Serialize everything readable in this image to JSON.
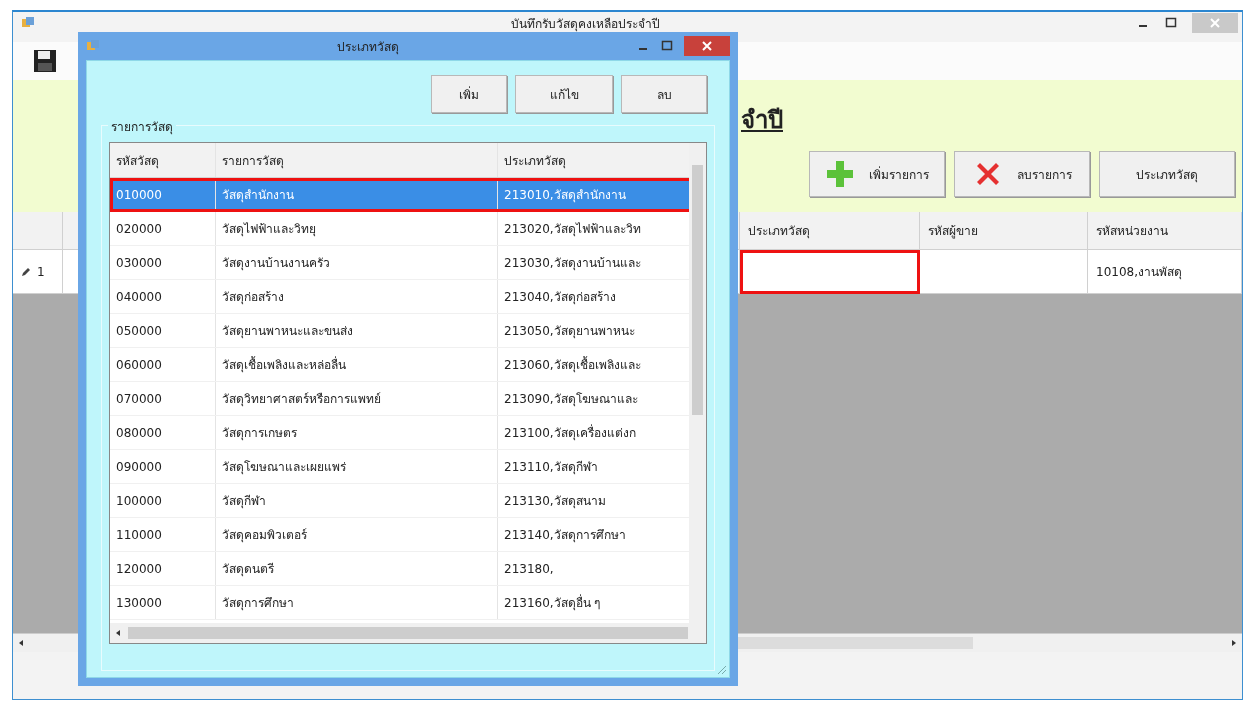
{
  "window": {
    "title": "บันทึกรับวัสดุคงเหลือประจำปี",
    "active": false
  },
  "heading": "จำปี",
  "actions": [
    {
      "kind": "add",
      "label": "เพิ่มรายการ"
    },
    {
      "kind": "delete",
      "label": "ลบรายการ"
    },
    {
      "kind": "plain",
      "label": "ประเภทวัสดุ"
    }
  ],
  "table": {
    "columns": [
      "ประเภทวัสดุ",
      "รหัสผู้ขาย",
      "รหัสหน่วยงาน"
    ],
    "rows": [
      {
        "row_number": "1",
        "editing": true,
        "cells": [
          {
            "highlighted": true
          },
          {
            "highlighted": false
          },
          {
            "text": "10108,งานพัสดุ",
            "highlighted": false
          }
        ]
      }
    ]
  },
  "dialog": {
    "title": "ประเภทวัสดุ",
    "active": true,
    "buttons": [
      "เพิ่ม",
      "แก้ไข",
      "ลบ"
    ],
    "group_label": "รายการวัสดุ",
    "columns": [
      "รหัสวัสดุ",
      "รายการวัสดุ",
      "ประเภทวัสดุ"
    ],
    "rows": [
      {
        "code": "010000",
        "name": "วัสดุสำนักงาน",
        "type": "213010,วัสดุสำนักงาน",
        "selected": true,
        "highlighted": true
      },
      {
        "code": "020000",
        "name": "วัสดุไฟฟ้าและวิทยุ",
        "type": "213020,วัสดุไฟฟ้าและวิท",
        "selected": false,
        "highlighted": false
      },
      {
        "code": "030000",
        "name": "วัสดุงานบ้านงานครัว",
        "type": "213030,วัสดุงานบ้านและ",
        "selected": false,
        "highlighted": false
      },
      {
        "code": "040000",
        "name": "วัสดุก่อสร้าง",
        "type": "213040,วัสดุก่อสร้าง",
        "selected": false,
        "highlighted": false
      },
      {
        "code": "050000",
        "name": "วัสดุยานพาหนะและขนส่ง",
        "type": "213050,วัสดุยานพาหนะ",
        "selected": false,
        "highlighted": false
      },
      {
        "code": "060000",
        "name": "วัสดุเชื้อเพลิงและหล่อลื่น",
        "type": "213060,วัสดุเชื้อเพลิงและ",
        "selected": false,
        "highlighted": false
      },
      {
        "code": "070000",
        "name": "วัสดุวิทยาศาสตร์หรือการแพทย์",
        "type": "213090,วัสดุโฆษณาและ",
        "selected": false,
        "highlighted": false
      },
      {
        "code": "080000",
        "name": "วัสดุการเกษตร",
        "type": "213100,วัสดุเครื่องแต่งก",
        "selected": false,
        "highlighted": false
      },
      {
        "code": "090000",
        "name": "วัสดุโฆษณาและเผยแพร่",
        "type": "213110,วัสดุกีฬา",
        "selected": false,
        "highlighted": false
      },
      {
        "code": "100000",
        "name": "วัสดุกีฬา",
        "type": "213130,วัสดุสนาม",
        "selected": false,
        "highlighted": false
      },
      {
        "code": "110000",
        "name": "วัสดุคอมพิวเตอร์",
        "type": "213140,วัสดุการศึกษา",
        "selected": false,
        "highlighted": false
      },
      {
        "code": "120000",
        "name": "วัสดุดนตรี",
        "type": "213180,",
        "selected": false,
        "highlighted": false
      },
      {
        "code": "130000",
        "name": "วัสดุการศึกษา",
        "type": "213160,วัสดุอื่น ๆ",
        "selected": false,
        "highlighted": false
      }
    ]
  }
}
